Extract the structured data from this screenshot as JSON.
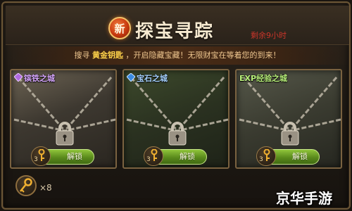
{
  "header": {
    "badge": "新",
    "title": "探宝寻踪",
    "remaining": "剩余9小时"
  },
  "subtitle": {
    "prefix": "搜寻",
    "highlight": "黄金钥匙",
    "suffix": "，开启隐藏宝藏！无限财宝在等着您的到来！"
  },
  "cards": [
    {
      "label": "镔铁之城",
      "key_count": "3",
      "button": "解锁",
      "locked": true
    },
    {
      "label": "宝石之城",
      "key_count": "3",
      "button": "解锁",
      "locked": true
    },
    {
      "label": "EXP经验之城",
      "key_count": "3",
      "button": "解锁",
      "locked": true
    }
  ],
  "inventory": {
    "count": "×8"
  },
  "watermark": "京华手游",
  "icons": {
    "badge": "new-badge-icon",
    "gem": "gem-icon",
    "lock": "padlock-icon",
    "key": "golden-key-icon"
  },
  "colors": {
    "accent": "#ffd24a",
    "button": "#5a8a1c",
    "remaining": "#c9352a"
  }
}
